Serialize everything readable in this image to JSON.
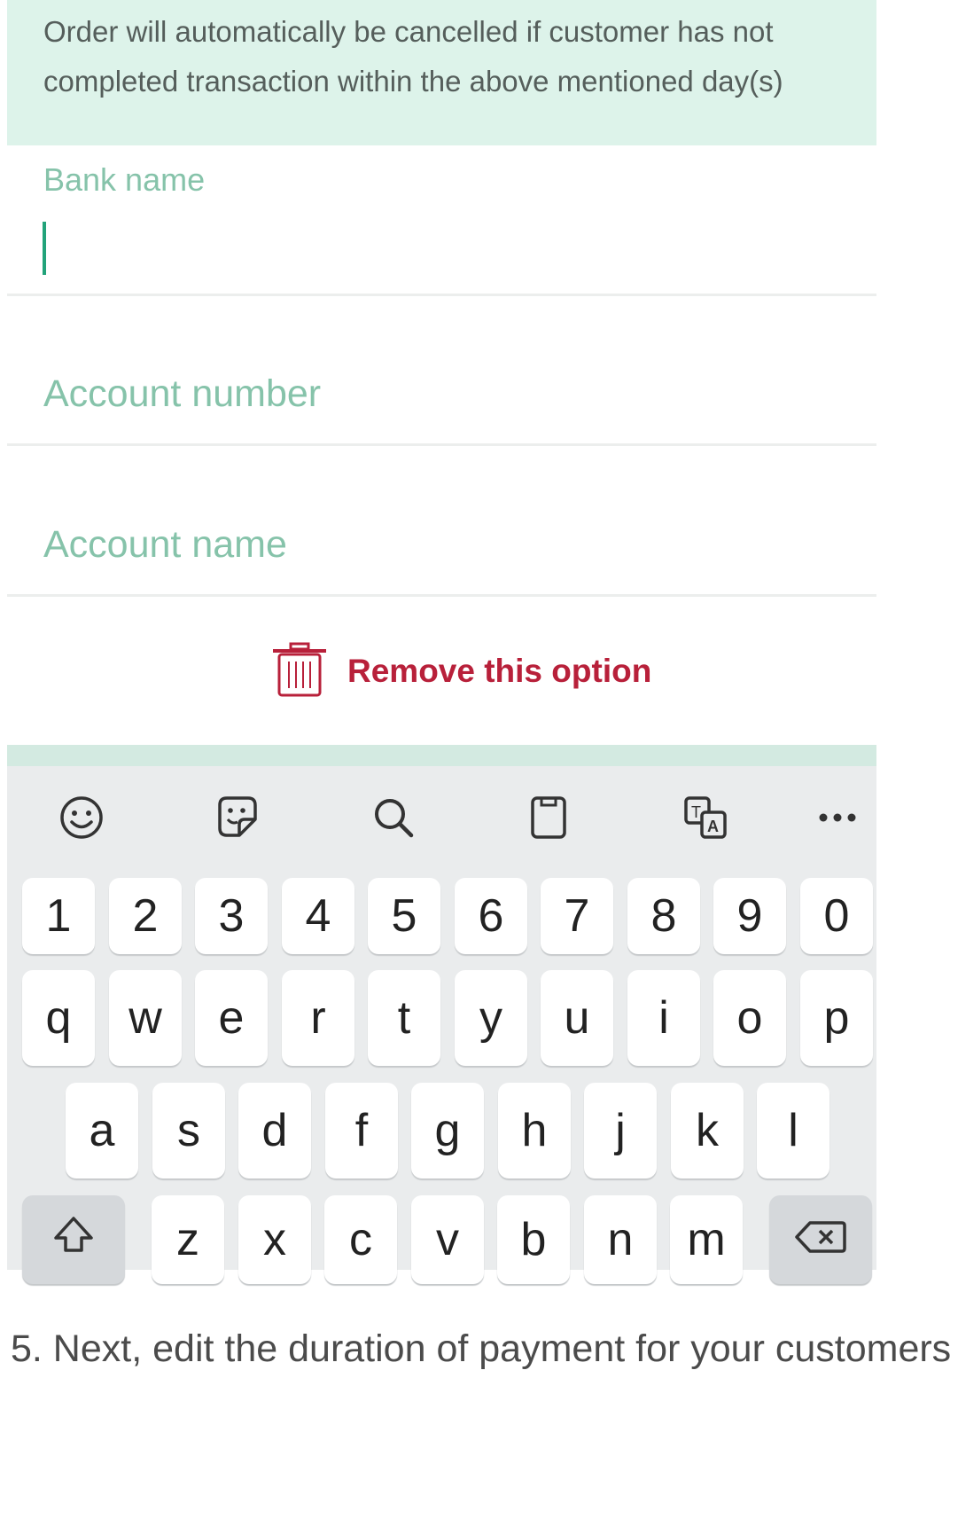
{
  "notice": {
    "text": "Order will automatically be cancelled if customer has not completed transaction within the above mentioned day(s)"
  },
  "form": {
    "bank_name_label": "Bank name",
    "account_number_label": "Account number",
    "account_name_label": "Account name",
    "remove_label": "Remove this option"
  },
  "keyboard": {
    "toolbar": [
      "emoji-icon",
      "sticker-icon",
      "search-icon",
      "clipboard-icon",
      "translate-icon",
      "more-options-icon"
    ],
    "rows": {
      "digits": [
        "1",
        "2",
        "3",
        "4",
        "5",
        "6",
        "7",
        "8",
        "9",
        "0"
      ],
      "top": [
        "q",
        "w",
        "e",
        "r",
        "t",
        "y",
        "u",
        "i",
        "o",
        "p"
      ],
      "middle": [
        "a",
        "s",
        "d",
        "f",
        "g",
        "h",
        "j",
        "k",
        "l"
      ],
      "bottom": [
        "z",
        "x",
        "c",
        "v",
        "b",
        "n",
        "m"
      ]
    },
    "shift_icon": "shift-icon",
    "backspace_icon": "backspace-icon"
  },
  "caption": "5. Next, edit the duration of payment for your customers",
  "colors": {
    "accent": "#22a37a",
    "label": "#86c3aa",
    "notice_bg": "#ddf3ea",
    "danger": "#b8203a"
  }
}
